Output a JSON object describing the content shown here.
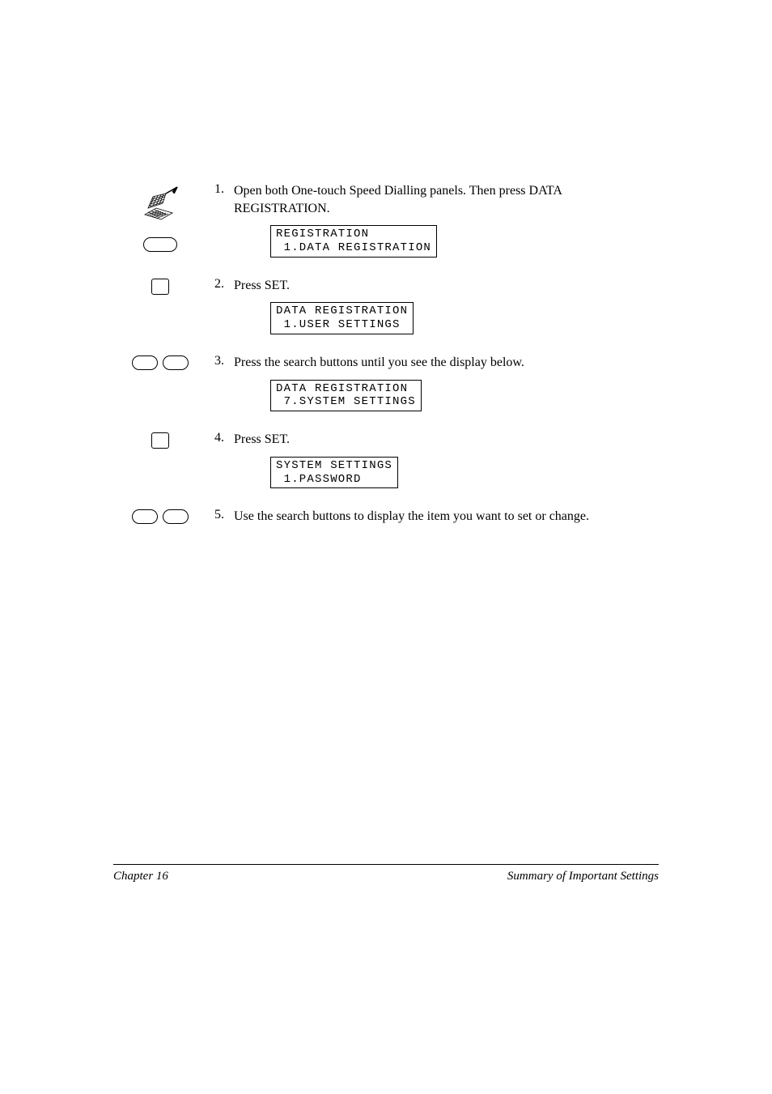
{
  "steps": [
    {
      "num": "1.",
      "text": "Open both One-touch Speed Dialling panels. Then press DATA REGISTRATION.",
      "lcd": {
        "line1": "REGISTRATION",
        "line2": " 1.DATA REGISTRATION"
      }
    },
    {
      "num": "2.",
      "text": "Press SET.",
      "lcd": {
        "line1": "DATA REGISTRATION",
        "line2": " 1.USER SETTINGS"
      }
    },
    {
      "num": "3.",
      "text": "Press the search buttons until you see the display below.",
      "lcd": {
        "line1": "DATA REGISTRATION",
        "line2": " 7.SYSTEM SETTINGS"
      }
    },
    {
      "num": "4.",
      "text": "Press SET.",
      "lcd": {
        "line1": "SYSTEM SETTINGS",
        "line2": " 1.PASSWORD"
      }
    },
    {
      "num": "5.",
      "text": "Use the search buttons to display the item you want to set or change.",
      "lcd": null
    }
  ],
  "footer": {
    "left": "Chapter 16",
    "right": "Summary of Important Settings"
  }
}
